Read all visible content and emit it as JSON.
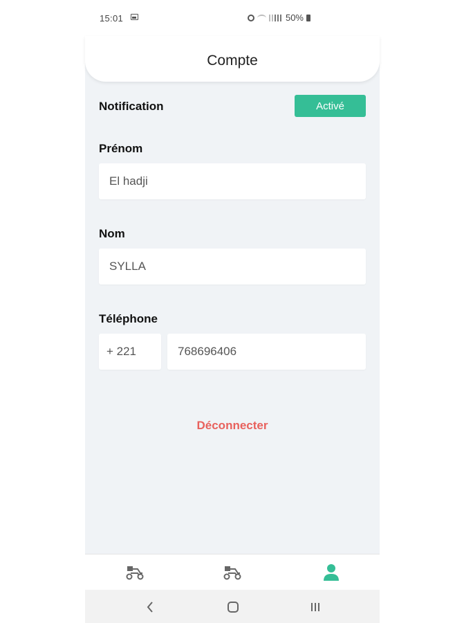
{
  "status_bar": {
    "time": "15:01",
    "battery": "50%"
  },
  "header": {
    "title": "Compte"
  },
  "notification": {
    "label": "Notification",
    "toggle_label": "Activé"
  },
  "form": {
    "first_name": {
      "label": "Prénom",
      "value": "El hadji"
    },
    "last_name": {
      "label": "Nom",
      "value": "SYLLA"
    },
    "phone": {
      "label": "Téléphone",
      "country_code": "+ 221",
      "number": "768696406"
    }
  },
  "logout_label": "Déconnecter",
  "bottom_nav": {
    "items": [
      {
        "icon": "delivery-scooter-icon",
        "active": false
      },
      {
        "icon": "delivery-scooter-icon",
        "active": false
      },
      {
        "icon": "user-icon",
        "active": true
      }
    ]
  },
  "colors": {
    "accent": "#35be96",
    "logout": "#e8615d",
    "background": "#f0f3f6"
  }
}
